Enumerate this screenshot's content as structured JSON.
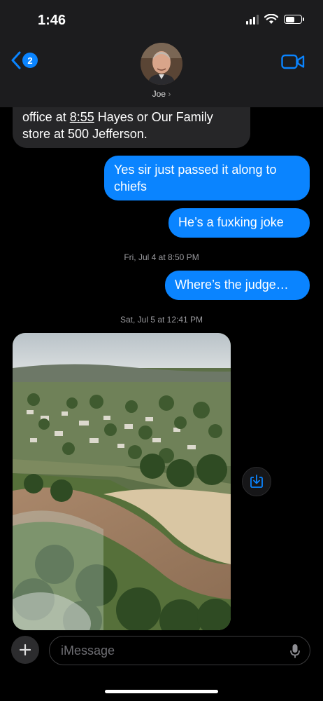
{
  "status": {
    "time": "1:46"
  },
  "header": {
    "back_count": "2",
    "contact_name": "Joe",
    "contact_chevron": "›"
  },
  "messages": [
    {
      "side": "incoming",
      "pre": "office at ",
      "link": "8:55",
      "post": " Hayes or Our Family store at 500 Jefferson."
    },
    {
      "side": "outgoing",
      "text": "Yes sir just passed it along to chiefs"
    },
    {
      "side": "outgoing",
      "text": "He’s a fuxking joke"
    },
    {
      "side": "timestamp",
      "text": "Fri, Jul 4 at 8:50 PM"
    },
    {
      "side": "outgoing",
      "text": "Where’s the judge…"
    },
    {
      "side": "timestamp",
      "text": "Sat, Jul 5 at 12:41 PM"
    }
  ],
  "photo": {
    "description_icon": "aerial-flood-photo"
  },
  "input": {
    "placeholder": "iMessage"
  },
  "icons": [
    "back-chevron-icon",
    "video-camera-icon",
    "save-download-icon",
    "plus-icon",
    "microphone-icon",
    "wifi-icon",
    "battery-icon",
    "signal-icon"
  ],
  "colors": {
    "accent": "#0a84ff",
    "incoming": "#262628",
    "header": "#1c1c1e"
  }
}
